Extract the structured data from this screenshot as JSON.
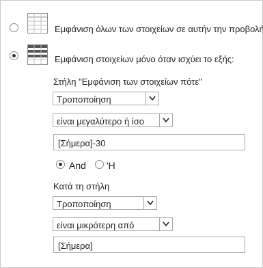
{
  "options": {
    "show_all": {
      "label": "Εμφάνιση όλων των στοιχείων σε αυτήν την προβολή",
      "selected": false,
      "icon": "table-icon"
    },
    "show_filtered": {
      "label": "Εμφάνιση στοιχείων μόνο όταν ισχύει το εξής:",
      "selected": true,
      "icon": "filtered-table-icon"
    }
  },
  "filter1": {
    "column_label": "Στήλη \"Εμφάνιση των στοιχείων πότε\"",
    "column_value": "Τροποποίηση",
    "operator_value": "είναι μεγαλύτερο ή ίσο",
    "value": "[Σήμερα]-30"
  },
  "logic": {
    "and_label": "And",
    "or_label": "'H",
    "selected": "and"
  },
  "filter2": {
    "column_label": "Κατά τη στήλη",
    "column_value": "Τροποποίηση",
    "operator_value": "είναι μικρότερη από",
    "value": "[Σήμερα]"
  },
  "colors": {
    "border": "#a9a9a9",
    "icon_blue": "#4472c4"
  }
}
